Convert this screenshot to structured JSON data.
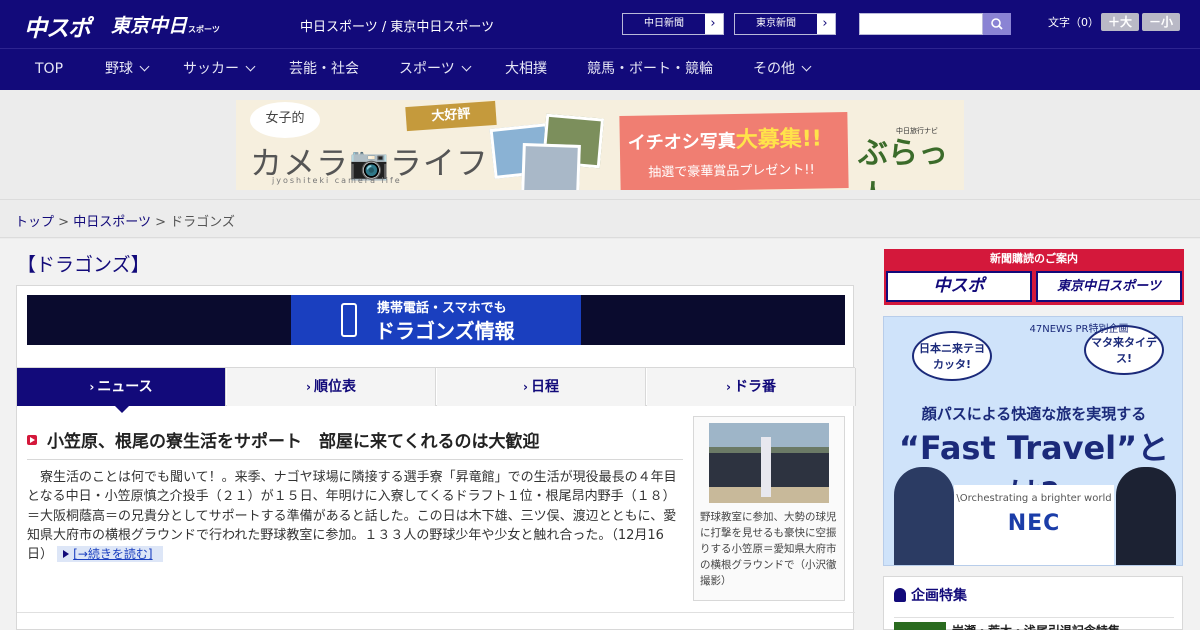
{
  "header": {
    "logo_main": "中スポ",
    "logo_tokyo": "東京中日",
    "logo_tokyo_small": "スポーツ",
    "site_title": "中日スポーツ / 東京中日スポーツ",
    "paper_links": [
      {
        "label": "中日新聞",
        "arrow": "›"
      },
      {
        "label": "東京新聞",
        "arrow": "›"
      }
    ],
    "search": {
      "placeholder": "",
      "value": ""
    },
    "font_size_label": "文字（0）",
    "font_larger": "＋大",
    "font_smaller": "－小"
  },
  "nav": {
    "items": [
      {
        "label": "TOP"
      },
      {
        "label": "野球"
      },
      {
        "label": "サッカー"
      },
      {
        "label": "芸能・社会"
      },
      {
        "label": "スポーツ"
      },
      {
        "label": "大相撲"
      },
      {
        "label": "競馬・ボート・競輪"
      },
      {
        "label": "その他"
      }
    ]
  },
  "banner": {
    "bubble": "女子的",
    "title": "カメラ📷ライフ",
    "subtitle": "jyoshiteki camera life",
    "ribbon": "大好評",
    "promo_prefix": "イチオシ写真",
    "promo_highlight": "大募集!!",
    "promo_sub": "抽選で豪華賞品プレゼント!!",
    "brand": "ぶらっ人",
    "brand_tag": "中日旅行ナビ"
  },
  "breadcrumb": {
    "items": [
      "トップ",
      "中日スポーツ",
      "ドラゴンズ"
    ],
    "separator": ">"
  },
  "page": {
    "title": "【ドラゴンズ】"
  },
  "mobile_banner": {
    "line1": "携帯電話・スマホでも",
    "line2": "ドラゴンズ情報"
  },
  "tabs": [
    {
      "label": "ニュース",
      "active": true
    },
    {
      "label": "順位表"
    },
    {
      "label": "日程"
    },
    {
      "label": "ドラ番"
    }
  ],
  "article": {
    "headline": "小笠原、根尾の寮生活をサポート　部屋に来てくれるのは大歓迎",
    "body": "寮生活のことは何でも聞いて！。来季、ナゴヤ球場に隣接する選手寮「昇竜館」での生活が現役最長の４年目となる中日・小笠原慎之介投手（２１）が１５日、年明けに入寮してくるドラフト１位・根尾昂内野手（１８）＝大阪桐蔭高＝の兄貴分としてサポートする準備があると話した。この日は木下雄、三ツ俣、渡辺とともに、愛知県大府市の横根グラウンドで行われた野球教室に参加。１３３人の野球少年や少女と触れ合った。（12月16日）",
    "more_label": "[→続きを読む]",
    "photo_caption": "野球教室に参加、大勢の球児に打撃を見せるも豪快に空振りする小笠原＝愛知県大府市の横根グラウンドで（小沢徹撮影）"
  },
  "sidebar": {
    "subscribe_title": "新聞購読のご案内",
    "subscribe_buttons": [
      "中スポ",
      "東京中日スポーツ"
    ],
    "ad": {
      "bubble_left": "日本ニ来テヨカッタ!",
      "bubble_right": "マタ来タイデス!",
      "news_tag": "47NEWS PR特別企画",
      "line1": "顔パスによる快適な旅を実現する",
      "line2": "“Fast Travel”とは?",
      "tagline": "\\Orchestrating a brighter world",
      "brand": "NEC"
    },
    "feature_title": "企画特集",
    "feature_item": "岩瀬・荒木・浅尾引退記念特集"
  },
  "colors": {
    "brand_navy": "#120a7a",
    "accent_red": "#d4183b",
    "link_blue": "#1a3fbf"
  }
}
